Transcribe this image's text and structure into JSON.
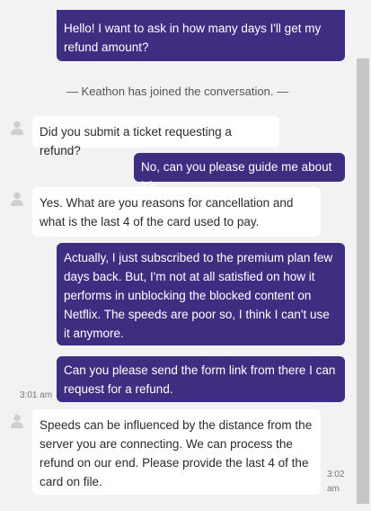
{
  "messages": [
    {
      "id": "m1",
      "type": "outgoing",
      "text": "Hello! I want to ask in how many days I'll get my refund amount?"
    },
    {
      "id": "sys1",
      "type": "system",
      "text": "— Keathon has joined the conversation. —"
    },
    {
      "id": "m2",
      "type": "incoming",
      "text": "Did you submit a ticket requesting a refund?"
    },
    {
      "id": "m3",
      "type": "outgoing",
      "text": "No, can you please guide me about it?"
    },
    {
      "id": "m4",
      "type": "incoming",
      "text": "Yes. What are you reasons for cancellation and what is the last 4 of the card used to pay."
    },
    {
      "id": "m5",
      "type": "outgoing",
      "text": "Actually, I just subscribed to the premium plan few days back. But, I'm not at all satisfied on how it performs in unblocking the blocked content on Netflix. The speeds are poor so, I think I can't use it anymore."
    },
    {
      "id": "m6",
      "type": "outgoing",
      "text": "Can you please send the form link from there I can request for a refund.",
      "time": "3:01 am"
    },
    {
      "id": "m7",
      "type": "incoming",
      "text": "Speeds can be influenced by the distance from the server you are connecting. We can process the refund on our end. Please provide the last 4 of the card on file.",
      "time_line1": "3:02",
      "time_line2": "am"
    }
  ],
  "icons": {
    "avatar": "user-silhouette-icon"
  },
  "colors": {
    "outgoing_bubble": "#3f2d82",
    "incoming_bubble": "#ffffff",
    "background": "#f2f2f2"
  }
}
